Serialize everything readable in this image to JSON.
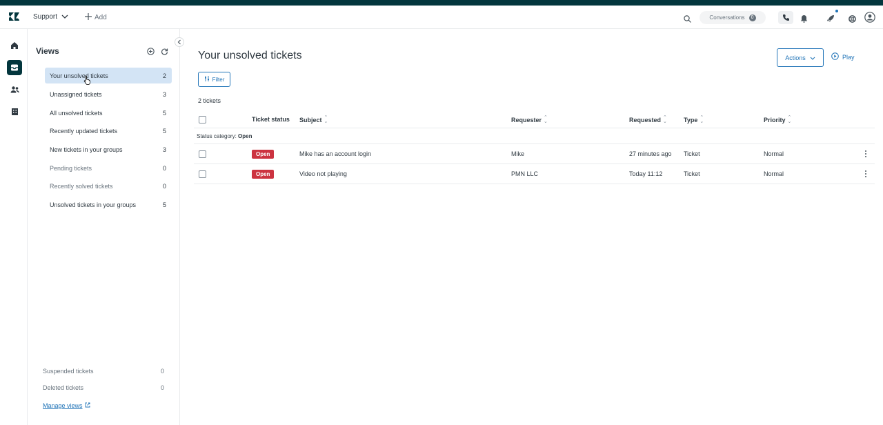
{
  "topbar": {
    "product": "Support",
    "add_label": "Add",
    "conversations_label": "Conversations",
    "conversations_count": "0"
  },
  "sidebar": {
    "title": "Views",
    "views": [
      {
        "label": "Your unsolved tickets",
        "count": "2",
        "active": true
      },
      {
        "label": "Unassigned tickets",
        "count": "3"
      },
      {
        "label": "All unsolved tickets",
        "count": "5"
      },
      {
        "label": "Recently updated tickets",
        "count": "5"
      },
      {
        "label": "New tickets in your groups",
        "count": "3"
      },
      {
        "label": "Pending tickets",
        "count": "0"
      },
      {
        "label": "Recently solved tickets",
        "count": "0"
      },
      {
        "label": "Unsolved tickets in your groups",
        "count": "5"
      }
    ],
    "bottom": [
      {
        "label": "Suspended tickets",
        "count": "0"
      },
      {
        "label": "Deleted tickets",
        "count": "0"
      }
    ],
    "manage_label": "Manage views"
  },
  "main": {
    "title": "Your unsolved tickets",
    "filter_label": "Filter",
    "actions_label": "Actions",
    "play_label": "Play",
    "ticket_count": "2 tickets",
    "columns": {
      "status": "Ticket status",
      "subject": "Subject",
      "requester": "Requester",
      "requested": "Requested",
      "type": "Type",
      "priority": "Priority"
    },
    "group_prefix": "Status category:",
    "group_value": "Open",
    "rows": [
      {
        "status": "Open",
        "subject": "Mike has an account login",
        "requester": "Mike",
        "requested": "27 minutes ago",
        "type": "Ticket",
        "priority": "Normal"
      },
      {
        "status": "Open",
        "subject": "Video not playing",
        "requester": "PMN LLC",
        "requested": "Today 11:12",
        "type": "Ticket",
        "priority": "Normal"
      }
    ]
  },
  "colors": {
    "brand_dark": "#03363d",
    "accent_blue": "#1f73b7",
    "active_bg": "#d3e4f5",
    "open_badge": "#cc3340"
  }
}
